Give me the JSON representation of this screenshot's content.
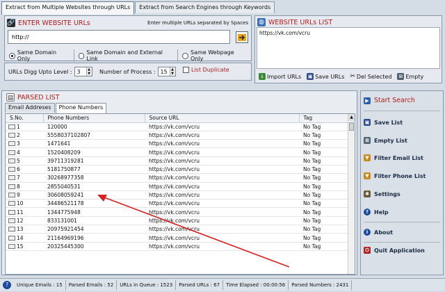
{
  "tabs": [
    "Extract from Multiple Websites through URLs",
    "Extract from Search Engines through Keywords"
  ],
  "enter": {
    "title": "ENTER WEBSITE URLs",
    "hint": "Enter multiple URLs separated by Spaces",
    "url_value": "http://",
    "radios": [
      "Same Domain Only",
      "Same Domain and External Link",
      "Same Webpage Only"
    ]
  },
  "settings": {
    "digg_label": "URLs Digg Upto Level :",
    "digg_value": "3",
    "process_label": "Number of Process :",
    "process_value": "15",
    "duplicate_label": "List Duplicate"
  },
  "urls": {
    "title": "WEBSITE URLs LIST",
    "items": [
      "https://vk.com/vcru"
    ],
    "import": "Import URLs",
    "save": "Save URLs",
    "del": "Del Selected",
    "empty": "Empty"
  },
  "parsed": {
    "title": "PARSED LIST",
    "subtabs": [
      "Email Addreses",
      "Phone Numbers"
    ],
    "columns": [
      "S.No.",
      "Phone Numbers",
      "Source URL",
      "Tag"
    ],
    "rows": [
      [
        "1",
        "120000",
        "https://vk.com/vcru",
        "No Tag"
      ],
      [
        "2",
        "5558037102807",
        "https://vk.com/vcru",
        "No Tag"
      ],
      [
        "3",
        "1471641",
        "https://vk.com/vcru",
        "No Tag"
      ],
      [
        "4",
        "1520408209",
        "https://vk.com/vcru",
        "No Tag"
      ],
      [
        "5",
        "39711319281",
        "https://vk.com/vcru",
        "No Tag"
      ],
      [
        "6",
        "5181750877",
        "https://vk.com/vcru",
        "No Tag"
      ],
      [
        "7",
        "30268977358",
        "https://vk.com/vcru",
        "No Tag"
      ],
      [
        "8",
        "2855040531",
        "https://vk.com/vcru",
        "No Tag"
      ],
      [
        "9",
        "30608059241",
        "https://vk.com/vcru",
        "No Tag"
      ],
      [
        "10",
        "34486521178",
        "https://vk.com/vcru",
        "No Tag"
      ],
      [
        "11",
        "1344775948",
        "https://vk.com/vcru",
        "No Tag"
      ],
      [
        "12",
        "833131001",
        "https://vk.com/vcru",
        "No Tag"
      ],
      [
        "13",
        "20975921454",
        "https://vk.com/vcru",
        "No Tag"
      ],
      [
        "14",
        "21164969196",
        "https://vk.com/vcru",
        "No Tag"
      ],
      [
        "15",
        "20325445300",
        "https://vk.com/vcru",
        "No Tag"
      ]
    ]
  },
  "actions": {
    "start": "Start Search",
    "save_list": "Save List",
    "empty_list": "Empty List",
    "filter_email": "Filter Email List",
    "filter_phone": "Filter Phone List",
    "settings": "Settings",
    "help": "Help",
    "about": "About",
    "quit": "Quit Application"
  },
  "status": {
    "unique_emails": "Unique Emails : 15",
    "parsed_emails": "Parsed Emails : 52",
    "urls_queue": "URLs in Queue : 1523",
    "parsed_urls": "Parsed URLs : 67",
    "time": "Time Elapsed : 00:00:56",
    "parsed_numbers": "Parsed Numbers : 2431"
  },
  "colors": {
    "accent_red": "#b11e1e",
    "annotation_arrow": "#d42020"
  }
}
